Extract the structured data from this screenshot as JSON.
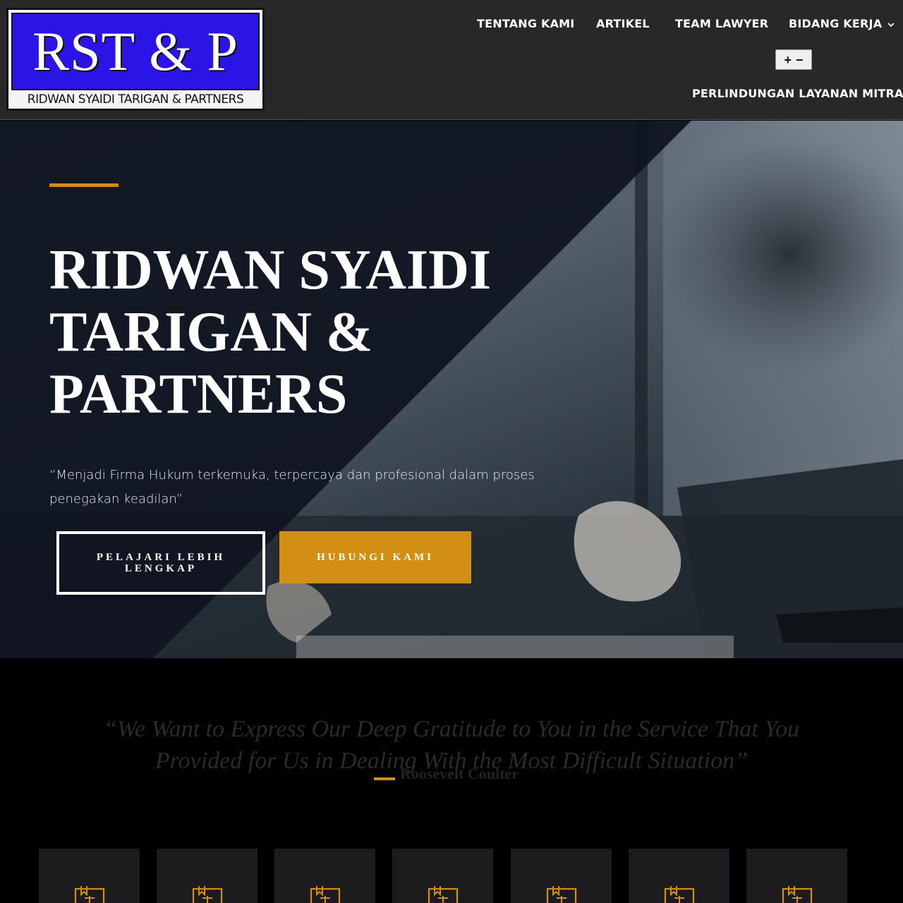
{
  "colors": {
    "accent": "#d38f13",
    "header_bg": "#282828",
    "logo_blue": "#2a14e6"
  },
  "logo": {
    "top_text": "RST & P",
    "bottom_text": "RIDWAN SYAIDI TARIGAN & PARTNERS"
  },
  "nav": {
    "items": [
      {
        "label": "TENTANG KAMI"
      },
      {
        "label": "ARTIKEL"
      },
      {
        "label": "TEAM LAWYER"
      },
      {
        "label": "BIDANG KERJA"
      },
      {
        "label": "PERLINDUNGAN LAYANAN MITRA"
      }
    ],
    "zoom_in": "+",
    "zoom_out": "−"
  },
  "hero": {
    "title": "RIDWAN SYAIDI TARIGAN & PARTNERS",
    "quote": "“Menjadi  Firma  Hukum terkemuka, terpercaya dan profesional dalam proses penegakan keadilan”",
    "btn_primary": "PELAJARI LEBIH LENGKAP",
    "btn_secondary": "HUBUNGI KAMI"
  },
  "testimonial": {
    "quote": "“We Want to Express Our Deep Gratitude to You in the Service That You Provided for Us in Dealing With the Most Difficult Situation”",
    "author": "Roosevelt Coulter"
  },
  "cards": [
    {
      "icon": "law-book-icon"
    },
    {
      "icon": "law-book-icon"
    },
    {
      "icon": "law-book-icon"
    },
    {
      "icon": "law-book-icon"
    },
    {
      "icon": "law-book-icon"
    },
    {
      "icon": "law-book-icon"
    },
    {
      "icon": "law-book-icon"
    }
  ]
}
